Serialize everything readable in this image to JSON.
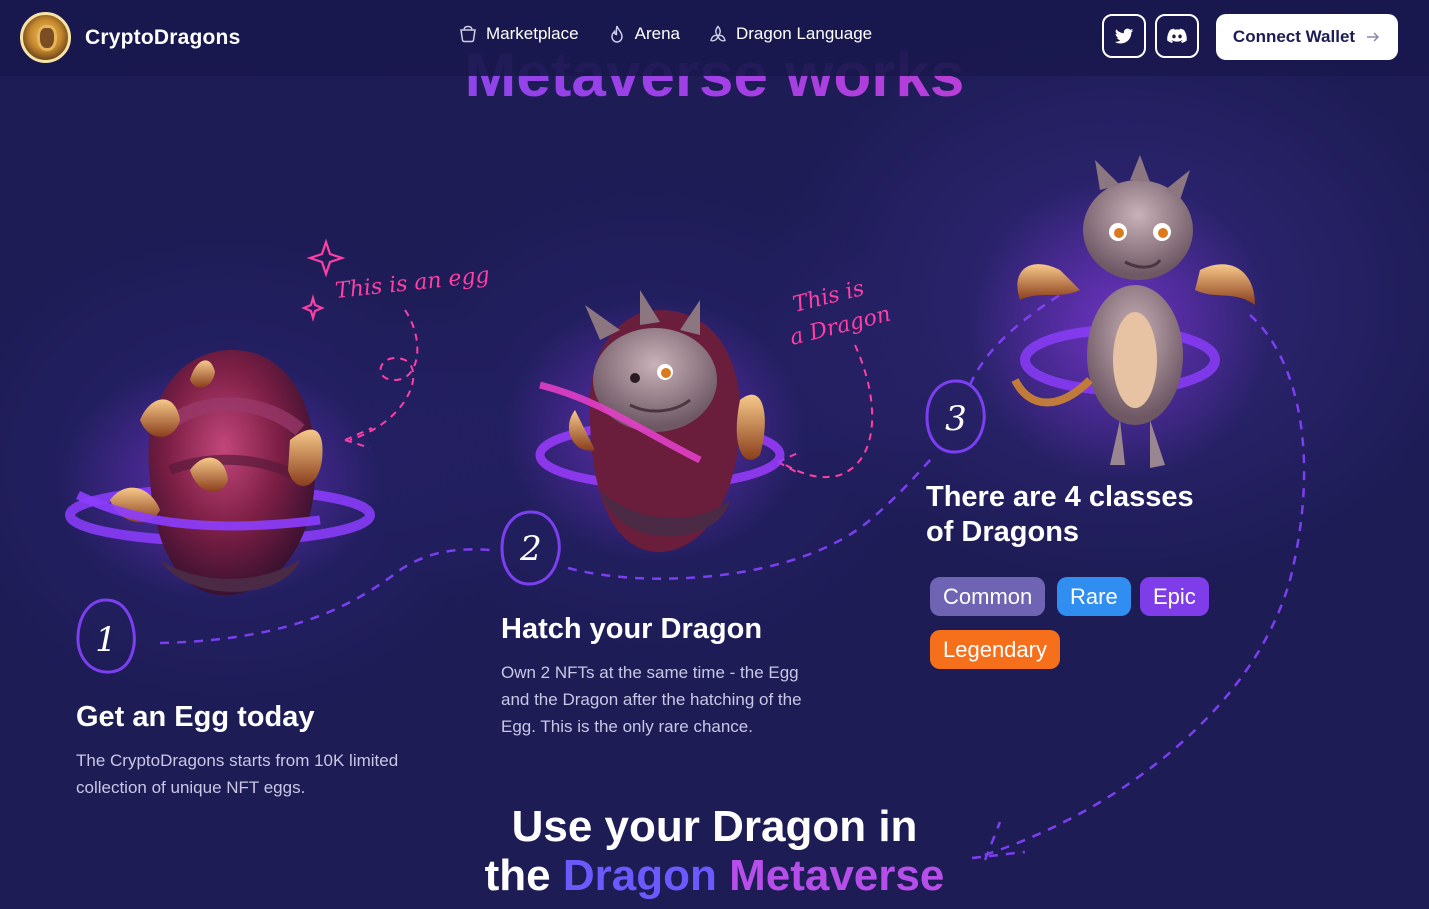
{
  "header": {
    "brand": "CryptoDragons",
    "nav": [
      {
        "label": "Marketplace",
        "icon": "basket-icon"
      },
      {
        "label": "Arena",
        "icon": "flame-icon"
      },
      {
        "label": "Dragon Language",
        "icon": "triquetra-icon"
      }
    ],
    "social": [
      {
        "icon": "twitter-icon"
      },
      {
        "icon": "discord-icon"
      }
    ],
    "connect_wallet": "Connect Wallet"
  },
  "section": {
    "heading_cut": "Metaverse works"
  },
  "annotations": {
    "egg_note": "This is an egg",
    "dragon_note_line1": "This is",
    "dragon_note_line2": "a Dragon"
  },
  "steps": [
    {
      "number": "1",
      "title": "Get an Egg today",
      "desc_line1": "The CryptoDragons starts from 10K limited",
      "desc_line2": "collection of unique NFT eggs."
    },
    {
      "number": "2",
      "title": "Hatch your Dragon",
      "desc_line1": "Own 2 NFTs at the same time - the Egg",
      "desc_line2": "and the Dragon after the hatching of the",
      "desc_line3": "Egg. This is the only rare chance."
    },
    {
      "number": "3",
      "title_line1": "There are 4 classes",
      "title_line2": "of Dragons"
    }
  ],
  "classes": [
    {
      "label": "Common",
      "color": "#6e64b3"
    },
    {
      "label": "Rare",
      "color": "#2f8ef0"
    },
    {
      "label": "Epic",
      "color": "#7f3ce9"
    },
    {
      "label": "Legendary",
      "color": "#f6701c"
    }
  ],
  "bottom": {
    "line1": "Use your Dragon in",
    "line2_pre": "the ",
    "line2_word1": "Dragon",
    "line2_word2": "Metaverse"
  },
  "colors": {
    "background": "#1d1c55",
    "accent_purple": "#7b3ff0",
    "accent_pink": "#ff3fa4"
  }
}
